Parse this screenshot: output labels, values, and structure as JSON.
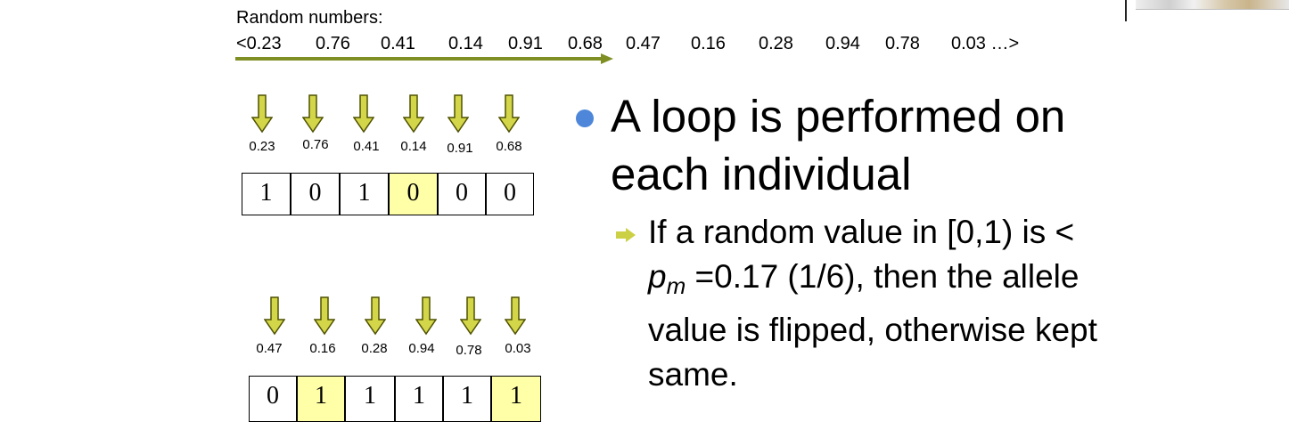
{
  "random_title": "Random numbers:",
  "random_sequence": [
    "<0.23",
    "0.76",
    "0.41",
    "0.14",
    "0.91",
    "0.68",
    "0.47",
    "0.16",
    "0.28",
    "0.94",
    "0.78",
    "0.03 …>"
  ],
  "individual_1": {
    "probabilities": [
      "0.23",
      "0.76",
      "0.41",
      "0.14",
      "0.91",
      "0.68"
    ],
    "bits": [
      "1",
      "0",
      "1",
      "0",
      "0",
      "0"
    ]
  },
  "individual_2": {
    "probabilities": [
      "0.47",
      "0.16",
      "0.28",
      "0.94",
      "0.78",
      "0.03"
    ],
    "bits": [
      "0",
      "1",
      "1",
      "1",
      "1",
      "1"
    ]
  },
  "bullet": {
    "line1": "A loop is performed on",
    "line2": "each individual"
  },
  "sub_bullet": {
    "line1": "If a random value in [0,1) is <",
    "pm_p": "p",
    "pm_m": "m",
    "line2_rest": " =0.17 (1/6), then the allele",
    "line3": "value is flipped, otherwise kept",
    "line4": "same."
  },
  "colors": {
    "progress_arrow": "#7f8f24",
    "down_arrow_fill": "#d4d64a",
    "down_arrow_stroke": "#4f5200",
    "flipped_cell": "#ffffa8",
    "bullet_dot": "#4e87d9",
    "sub_bullet_arrow": "#cbd044"
  }
}
